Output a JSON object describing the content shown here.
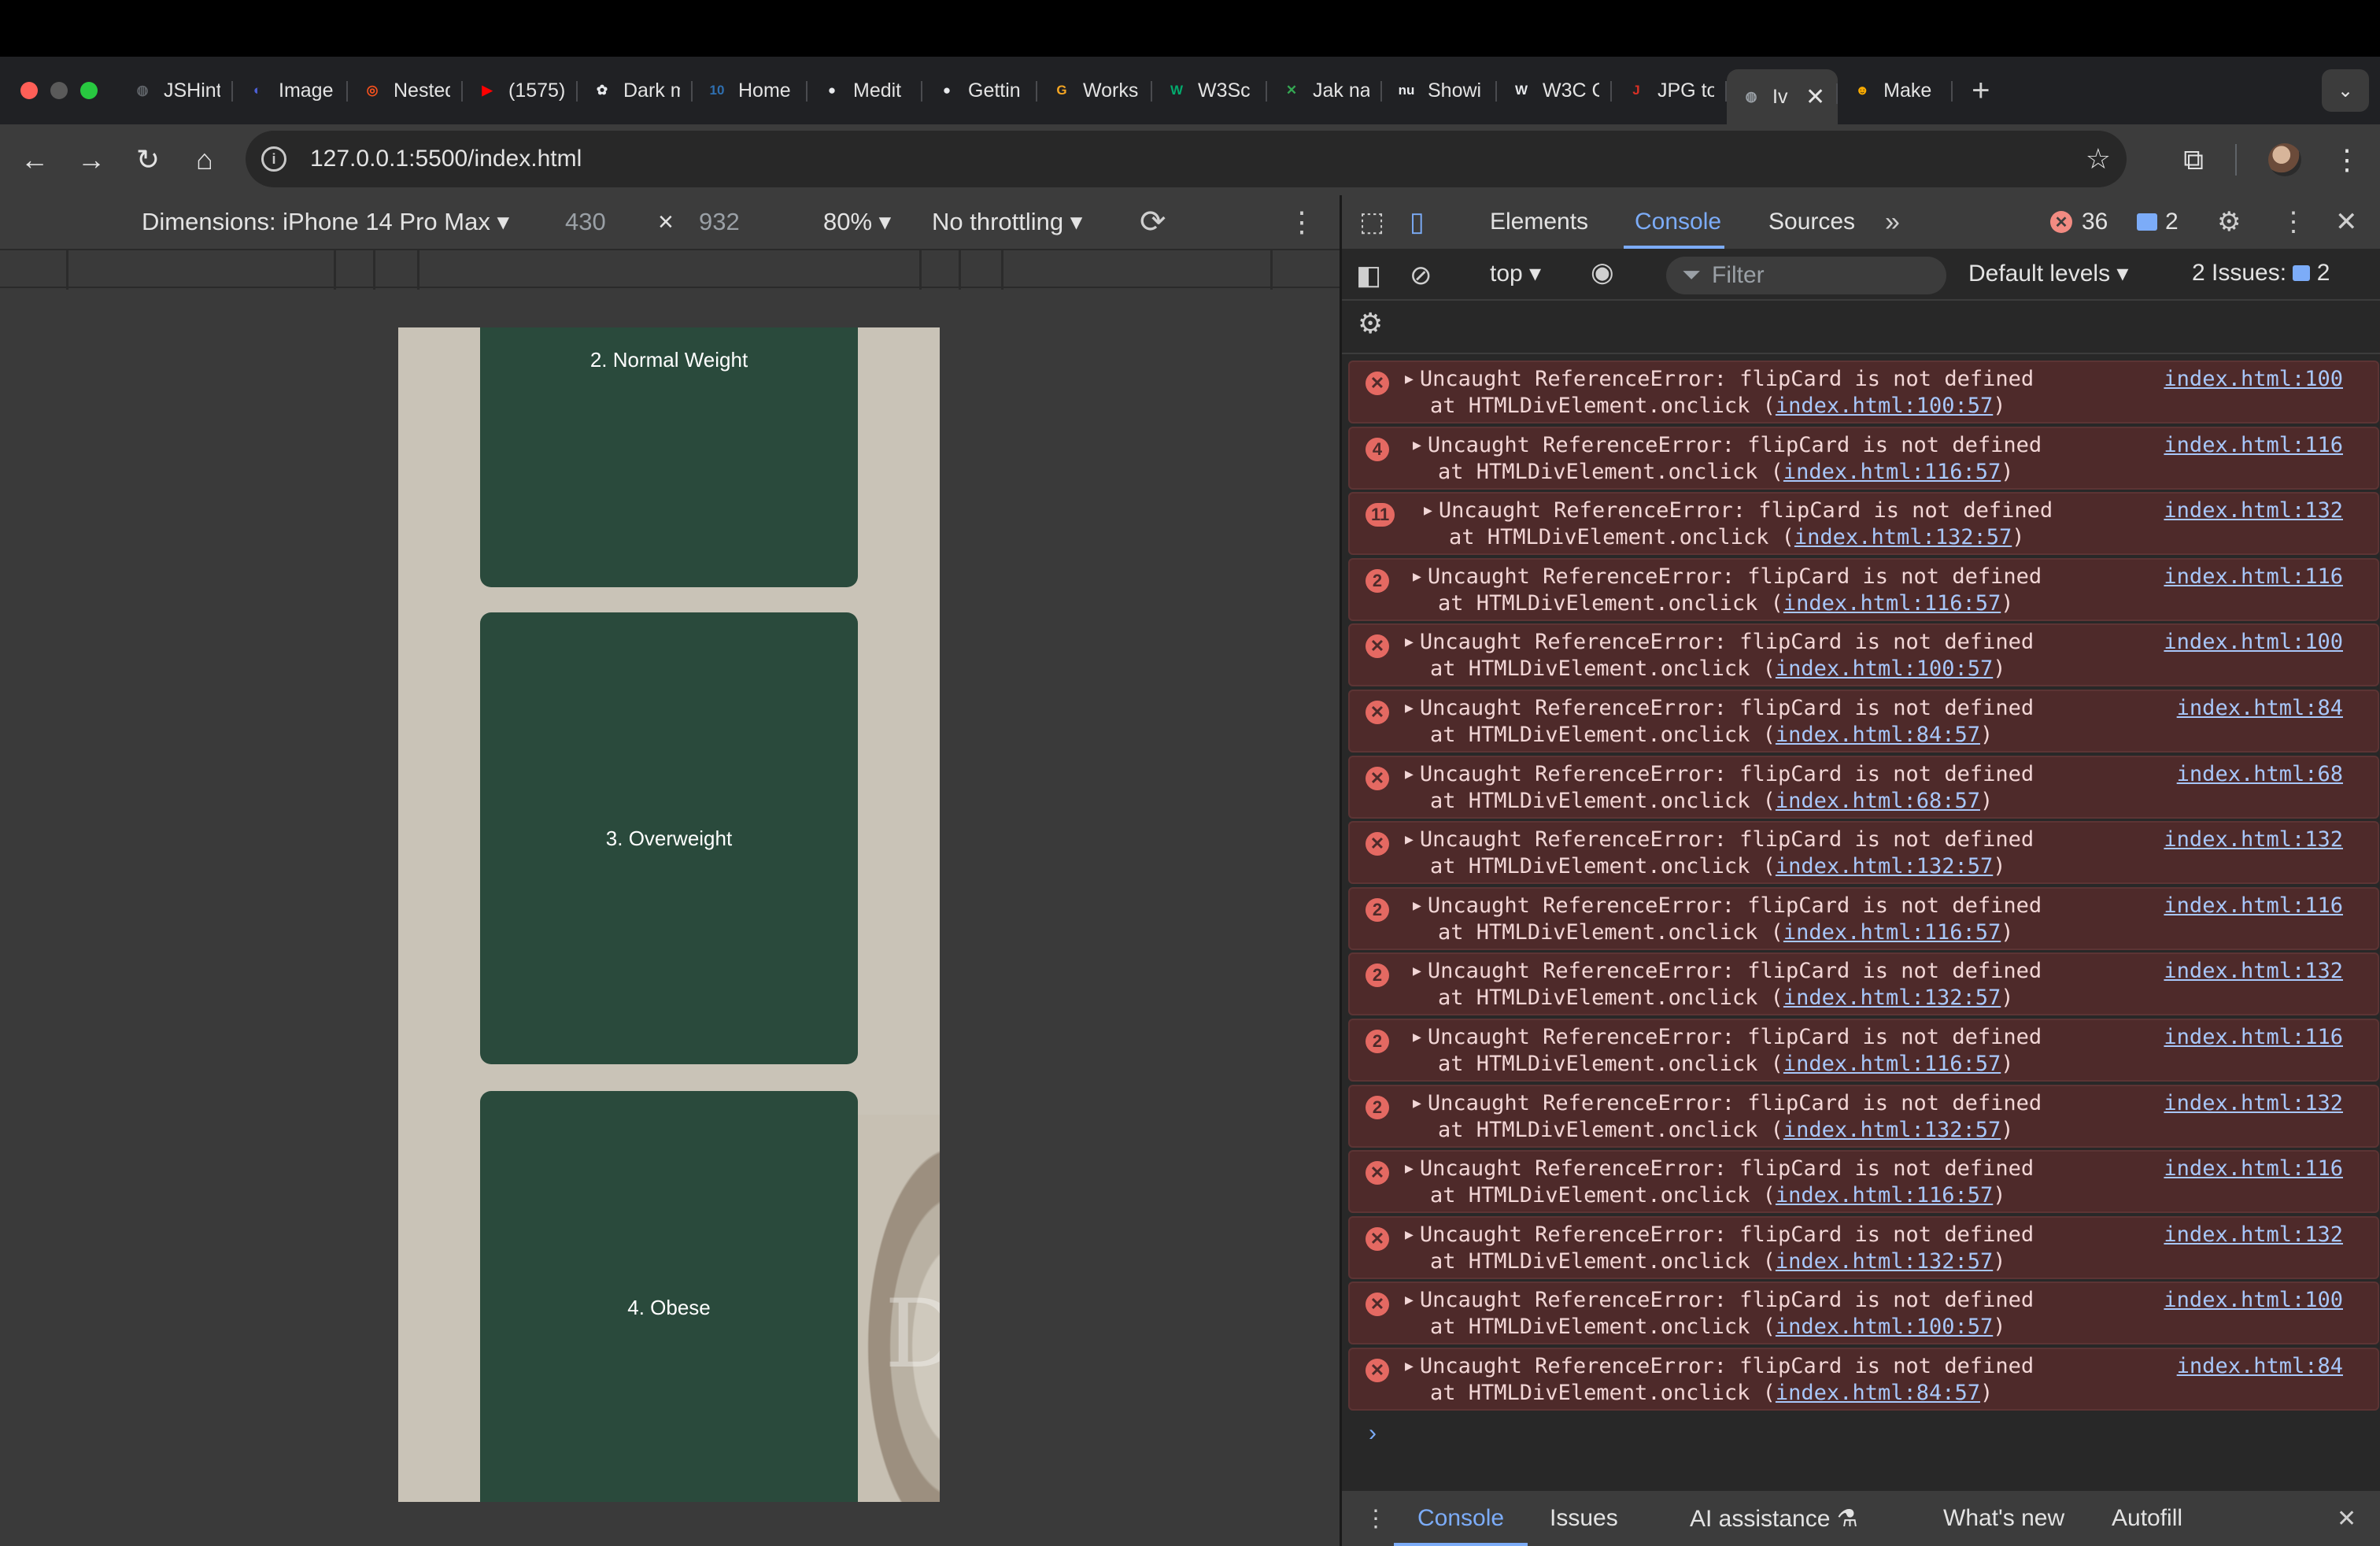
{
  "browser": {
    "tabs": [
      {
        "title": "JSHint",
        "icon": "globe-icon",
        "color": "#5f6368"
      },
      {
        "title": "Image",
        "icon": "image-icon",
        "color": "#4c5fd5"
      },
      {
        "title": "Nested",
        "icon": "target-icon",
        "color": "#f4511e"
      },
      {
        "title": "(1575)",
        "icon": "youtube-icon",
        "color": "#ff0000"
      },
      {
        "title": "Dark m",
        "icon": "openai-icon",
        "color": "#e8eaed"
      },
      {
        "title": "Home",
        "icon": "ten-icon",
        "color": "#2f6fb0"
      },
      {
        "title": "Medit",
        "icon": "github-icon",
        "color": "#e8eaed"
      },
      {
        "title": "Gettin",
        "icon": "github-icon",
        "color": "#e8eaed"
      },
      {
        "title": "Works",
        "icon": "g-icon",
        "color": "#f5a623"
      },
      {
        "title": "W3Sc",
        "icon": "w3schools-icon",
        "color": "#04aa6d"
      },
      {
        "title": "Jak na",
        "icon": "tools-icon",
        "color": "#34a853"
      },
      {
        "title": "Showi",
        "icon": "nu-icon",
        "color": "#e8eaed"
      },
      {
        "title": "W3C C",
        "icon": "w3c-icon",
        "color": "#e8eaed"
      },
      {
        "title": "JPG to",
        "icon": "jpg-icon",
        "color": "#d93025"
      },
      {
        "title": "Iv",
        "icon": "globe-icon",
        "color": "#9aa0a6",
        "active": true
      },
      {
        "title": "Make",
        "icon": "emoji-icon",
        "color": "#f9ab00"
      }
    ],
    "url": "127.0.0.1:5500/index.html"
  },
  "device_toolbar": {
    "dimensions_label": "Dimensions: iPhone 14 Pro Max",
    "width": "430",
    "times": "×",
    "height": "932",
    "zoom": "80%",
    "throttling": "No throttling"
  },
  "page": {
    "cards": [
      "2. Normal Weight",
      "3. Overweight",
      "4. Obese"
    ],
    "card_color": "#2a4a3c",
    "background_color": "#c9c3b7"
  },
  "devtools": {
    "tabs": [
      "Elements",
      "Console",
      "Sources"
    ],
    "active_tab": "Console",
    "error_count": "36",
    "message_count": "2",
    "context": "top",
    "filter_placeholder": "Filter",
    "levels": "Default levels",
    "issues_label": "2 Issues:",
    "issues_count": "2",
    "errors": [
      {
        "badge": "x",
        "line1": "Uncaught ReferenceError: flipCard is not defined",
        "line2_prefix": "at HTMLDivElement.onclick (",
        "link": "index.html:100:57",
        "line2_suffix": ")",
        "source": "index.html:100"
      },
      {
        "badge": "4",
        "line1": "Uncaught ReferenceError: flipCard is not defined",
        "line2_prefix": "at HTMLDivElement.onclick (",
        "link": "index.html:116:57",
        "line2_suffix": ")",
        "source": "index.html:116"
      },
      {
        "badge": "11",
        "line1": "Uncaught ReferenceError: flipCard is not defined",
        "line2_prefix": "at HTMLDivElement.onclick (",
        "link": "index.html:132:57",
        "line2_suffix": ")",
        "source": "index.html:132"
      },
      {
        "badge": "2",
        "line1": "Uncaught ReferenceError: flipCard is not defined",
        "line2_prefix": "at HTMLDivElement.onclick (",
        "link": "index.html:116:57",
        "line2_suffix": ")",
        "source": "index.html:116"
      },
      {
        "badge": "x",
        "line1": "Uncaught ReferenceError: flipCard is not defined",
        "line2_prefix": "at HTMLDivElement.onclick (",
        "link": "index.html:100:57",
        "line2_suffix": ")",
        "source": "index.html:100"
      },
      {
        "badge": "x",
        "line1": "Uncaught ReferenceError: flipCard is not defined",
        "line2_prefix": "at HTMLDivElement.onclick (",
        "link": "index.html:84:57",
        "line2_suffix": ")",
        "source": "index.html:84"
      },
      {
        "badge": "x",
        "line1": "Uncaught ReferenceError: flipCard is not defined",
        "line2_prefix": "at HTMLDivElement.onclick (",
        "link": "index.html:68:57",
        "line2_suffix": ")",
        "source": "index.html:68"
      },
      {
        "badge": "x",
        "line1": "Uncaught ReferenceError: flipCard is not defined",
        "line2_prefix": "at HTMLDivElement.onclick (",
        "link": "index.html:132:57",
        "line2_suffix": ")",
        "source": "index.html:132"
      },
      {
        "badge": "2",
        "line1": "Uncaught ReferenceError: flipCard is not defined",
        "line2_prefix": "at HTMLDivElement.onclick (",
        "link": "index.html:116:57",
        "line2_suffix": ")",
        "source": "index.html:116"
      },
      {
        "badge": "2",
        "line1": "Uncaught ReferenceError: flipCard is not defined",
        "line2_prefix": "at HTMLDivElement.onclick (",
        "link": "index.html:132:57",
        "line2_suffix": ")",
        "source": "index.html:132"
      },
      {
        "badge": "2",
        "line1": "Uncaught ReferenceError: flipCard is not defined",
        "line2_prefix": "at HTMLDivElement.onclick (",
        "link": "index.html:116:57",
        "line2_suffix": ")",
        "source": "index.html:116"
      },
      {
        "badge": "2",
        "line1": "Uncaught ReferenceError: flipCard is not defined",
        "line2_prefix": "at HTMLDivElement.onclick (",
        "link": "index.html:132:57",
        "line2_suffix": ")",
        "source": "index.html:132"
      },
      {
        "badge": "x",
        "line1": "Uncaught ReferenceError: flipCard is not defined",
        "line2_prefix": "at HTMLDivElement.onclick (",
        "link": "index.html:116:57",
        "line2_suffix": ")",
        "source": "index.html:116"
      },
      {
        "badge": "x",
        "line1": "Uncaught ReferenceError: flipCard is not defined",
        "line2_prefix": "at HTMLDivElement.onclick (",
        "link": "index.html:132:57",
        "line2_suffix": ")",
        "source": "index.html:132"
      },
      {
        "badge": "x",
        "line1": "Uncaught ReferenceError: flipCard is not defined",
        "line2_prefix": "at HTMLDivElement.onclick (",
        "link": "index.html:100:57",
        "line2_suffix": ")",
        "source": "index.html:100"
      },
      {
        "badge": "x",
        "line1": "Uncaught ReferenceError: flipCard is not defined",
        "line2_prefix": "at HTMLDivElement.onclick (",
        "link": "index.html:84:57",
        "line2_suffix": ")",
        "source": "index.html:84"
      }
    ],
    "drawer_tabs": [
      "Console",
      "Issues",
      "AI assistance",
      "What's new",
      "Autofill"
    ],
    "error_color": "#e46962",
    "accent": "#7cacf8"
  }
}
